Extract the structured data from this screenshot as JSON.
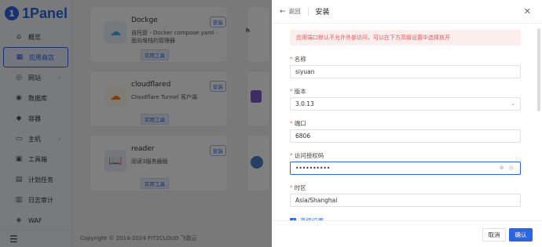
{
  "brand": {
    "name": "1Panel"
  },
  "sidebar": {
    "items": [
      {
        "label": "概览",
        "icon": "home-icon",
        "glyph": "⌂",
        "active": false,
        "expand": false
      },
      {
        "label": "应用商店",
        "icon": "app-store-icon",
        "glyph": "▦",
        "active": true,
        "expand": false
      },
      {
        "label": "网站",
        "icon": "globe-icon",
        "glyph": "◎",
        "active": false,
        "expand": true
      },
      {
        "label": "数据库",
        "icon": "database-icon",
        "glyph": "◉",
        "active": false,
        "expand": false
      },
      {
        "label": "容器",
        "icon": "docker-icon",
        "glyph": "◆",
        "active": false,
        "expand": false
      },
      {
        "label": "主机",
        "icon": "host-icon",
        "glyph": "▭",
        "active": false,
        "expand": true
      },
      {
        "label": "工具箱",
        "icon": "toolbox-icon",
        "glyph": "▣",
        "active": false,
        "expand": false
      },
      {
        "label": "计划任务",
        "icon": "cron-icon",
        "glyph": "▤",
        "active": false,
        "expand": false
      },
      {
        "label": "日志审计",
        "icon": "log-icon",
        "glyph": "▥",
        "active": false,
        "expand": false
      },
      {
        "label": "WAF",
        "icon": "waf-icon",
        "glyph": "◈",
        "active": false,
        "expand": false
      }
    ],
    "collapse_icon": "☰"
  },
  "apps": [
    {
      "name": "Dockge",
      "desc": "自托管 - Docker compose.yaml - 面向堆栈的管理器",
      "tag": "实用工具",
      "install": "安装",
      "icon": "dockge-icon",
      "glyph": "☁",
      "color": "#e8f3fb",
      "fg": "#53a7e0"
    },
    {
      "name": "cloudflared",
      "desc": "Cloudflare Tunnel 客户端",
      "tag": "实用工具",
      "install": "安装",
      "icon": "cloudflare-icon",
      "glyph": "☁",
      "color": "#fff6ec",
      "fg": "#f38020"
    },
    {
      "name": "reader",
      "desc": "阅读3服务器版",
      "tag": "实用工具",
      "install": "安装",
      "icon": "reader-icon",
      "glyph": "📖",
      "color": "#e8effd",
      "fg": "#2d64e2"
    }
  ],
  "footer": {
    "copyright": "Copyright © 2014-2024 FIT2CLOUD 飞致云"
  },
  "drawer": {
    "back": "返回",
    "title": "安装",
    "alert": "应用端口默认不允许外部访问，可以在下方高级设置中选择放开",
    "fields": {
      "name": {
        "label": "名称",
        "value": "siyuan"
      },
      "version": {
        "label": "版本",
        "value": "3.0.13"
      },
      "port": {
        "label": "端口",
        "value": "6806"
      },
      "code": {
        "label": "访问授权码",
        "value": "••••••••••"
      },
      "timezone": {
        "label": "时区",
        "value": "Asia/Shanghai"
      }
    },
    "advanced": "高级设置",
    "cancel": "取消",
    "confirm": "确认"
  }
}
